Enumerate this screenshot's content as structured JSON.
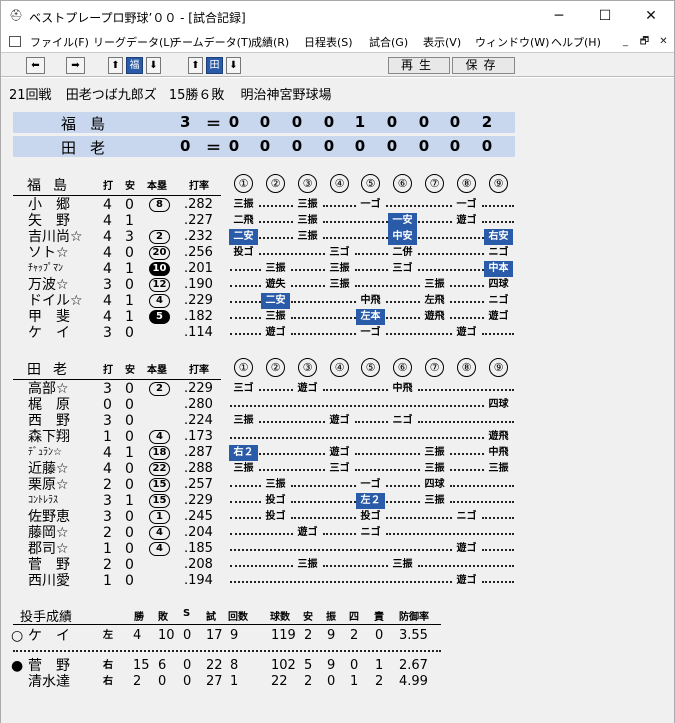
{
  "window": {
    "title": "ベストプレープロ野球’００ - [試合記録]",
    "minimize": "─",
    "maximize": "☐",
    "close": "✕"
  },
  "menu": [
    "ファイル(F)",
    "リーグデータ(L)",
    "チームデータ(T)",
    "成績(R)",
    "日程表(S)",
    "試合(G)",
    "表示(V)",
    "ウィンドウ(W)",
    "ヘルプ(H)"
  ],
  "mdi": {
    "minimize": "_",
    "restore": "🗗",
    "close": "✕"
  },
  "toolbar": {
    "prev": "⬅",
    "next": "➡",
    "up1": "⬆",
    "team1": "福",
    "down1": "⬇",
    "up2": "⬆",
    "team2": "田",
    "down2": "⬇",
    "play": "再生",
    "save": "保存"
  },
  "game": {
    "round": "21回戦",
    "pitchers": "田老つば九郎ズ",
    "record": "15勝６敗",
    "venue": "明治神宮野球場"
  },
  "scoreboard": [
    {
      "team": "福島",
      "total": "3",
      "eq": "＝",
      "innings": [
        "0",
        "0",
        "0",
        "0",
        "1",
        "0",
        "0",
        "0",
        "2"
      ]
    },
    {
      "team": "田老",
      "total": "0",
      "eq": "＝",
      "innings": [
        "0",
        "0",
        "0",
        "0",
        "0",
        "0",
        "0",
        "0",
        "0"
      ]
    }
  ],
  "col_headers": {
    "ab": "打",
    "hit": "安",
    "hr": "本塁",
    "avg": "打率",
    "innings": [
      "①",
      "②",
      "③",
      "④",
      "⑤",
      "⑥",
      "⑦",
      "⑧",
      "⑨"
    ]
  },
  "team_fukushima": {
    "name": "福島",
    "batters": [
      {
        "name": "小　郷",
        "ab": "4",
        "h": "0",
        "hr": "8",
        "hr_fill": false,
        "avg": ".282"
      },
      {
        "name": "矢　野",
        "ab": "4",
        "h": "1",
        "hr": "",
        "hr_fill": false,
        "avg": ".227"
      },
      {
        "name": "吉川尚☆",
        "ab": "4",
        "h": "3",
        "hr": "2",
        "hr_fill": false,
        "avg": ".232"
      },
      {
        "name": "ソト☆",
        "ab": "4",
        "h": "0",
        "hr": "20",
        "hr_fill": false,
        "avg": ".256"
      },
      {
        "name": "ﾁｬｯﾌﾟﾏﾝ",
        "ab": "4",
        "h": "1",
        "hr": "10",
        "hr_fill": true,
        "avg": ".201"
      },
      {
        "name": "万波☆",
        "ab": "3",
        "h": "0",
        "hr": "12",
        "hr_fill": false,
        "avg": ".190"
      },
      {
        "name": "ドイル☆",
        "ab": "4",
        "h": "1",
        "hr": "4",
        "hr_fill": false,
        "avg": ".229"
      },
      {
        "name": "甲　斐",
        "ab": "4",
        "h": "1",
        "hr": "5",
        "hr_fill": true,
        "avg": ".182"
      },
      {
        "name": "ケ　イ",
        "ab": "3",
        "h": "0",
        "hr": "",
        "hr_fill": false,
        "avg": ".114"
      }
    ],
    "results": [
      [
        {
          "c": 1,
          "t": "三振"
        },
        {
          "c": 3,
          "t": "三振"
        },
        {
          "c": 5,
          "t": "一ゴ"
        },
        {
          "c": 8,
          "t": "一ゴ"
        }
      ],
      [
        {
          "c": 1,
          "t": "二飛"
        },
        {
          "c": 3,
          "t": "三振"
        },
        {
          "c": 6,
          "t": "一安",
          "h": true
        },
        {
          "c": 8,
          "t": "遊ゴ"
        }
      ],
      [
        {
          "c": 1,
          "t": "二安",
          "h": true
        },
        {
          "c": 3,
          "t": "三振"
        },
        {
          "c": 6,
          "t": "中安",
          "h": true
        },
        {
          "c": 9,
          "t": "右安",
          "h": true
        }
      ],
      [
        {
          "c": 1,
          "t": "投ゴ"
        },
        {
          "c": 4,
          "t": "三ゴ"
        },
        {
          "c": 6,
          "t": "二併"
        },
        {
          "c": 9,
          "t": "ニゴ"
        }
      ],
      [
        {
          "c": 2,
          "t": "三振"
        },
        {
          "c": 4,
          "t": "三振"
        },
        {
          "c": 6,
          "t": "三ゴ"
        },
        {
          "c": 9,
          "t": "中本",
          "h": true
        }
      ],
      [
        {
          "c": 2,
          "t": "遊失"
        },
        {
          "c": 4,
          "t": "三振"
        },
        {
          "c": 7,
          "t": "三振"
        },
        {
          "c": 9,
          "t": "四球"
        }
      ],
      [
        {
          "c": 2,
          "t": "二安",
          "h": true
        },
        {
          "c": 5,
          "t": "中飛"
        },
        {
          "c": 7,
          "t": "左飛"
        },
        {
          "c": 9,
          "t": "ニゴ"
        }
      ],
      [
        {
          "c": 2,
          "t": "三振"
        },
        {
          "c": 5,
          "t": "左本",
          "h": true
        },
        {
          "c": 7,
          "t": "遊飛"
        },
        {
          "c": 9,
          "t": "遊ゴ"
        }
      ],
      [
        {
          "c": 2,
          "t": "遊ゴ"
        },
        {
          "c": 5,
          "t": "一ゴ"
        },
        {
          "c": 8,
          "t": "遊ゴ"
        }
      ]
    ]
  },
  "team_taro": {
    "name": "田老",
    "batters": [
      {
        "name": "高部☆",
        "ab": "3",
        "h": "0",
        "hr": "2",
        "hr_fill": false,
        "avg": ".229"
      },
      {
        "name": "梶　原",
        "ab": "0",
        "h": "0",
        "hr": "",
        "hr_fill": false,
        "avg": ".280"
      },
      {
        "name": "西　野",
        "ab": "3",
        "h": "0",
        "hr": "",
        "hr_fill": false,
        "avg": ".224"
      },
      {
        "name": "森下翔",
        "ab": "1",
        "h": "0",
        "hr": "4",
        "hr_fill": false,
        "avg": ".173"
      },
      {
        "name": "ﾃﾞｭﾗﾝ☆",
        "ab": "4",
        "h": "1",
        "hr": "18",
        "hr_fill": false,
        "avg": ".287"
      },
      {
        "name": "近藤☆",
        "ab": "4",
        "h": "0",
        "hr": "22",
        "hr_fill": false,
        "avg": ".288"
      },
      {
        "name": "栗原☆",
        "ab": "2",
        "h": "0",
        "hr": "15",
        "hr_fill": false,
        "avg": ".257"
      },
      {
        "name": "ｺﾝﾄﾚﾗｽ",
        "ab": "3",
        "h": "1",
        "hr": "15",
        "hr_fill": false,
        "avg": ".229"
      },
      {
        "name": "佐野恵",
        "ab": "3",
        "h": "0",
        "hr": "1",
        "hr_fill": false,
        "avg": ".245"
      },
      {
        "name": "藤岡☆",
        "ab": "2",
        "h": "0",
        "hr": "4",
        "hr_fill": false,
        "avg": ".204"
      },
      {
        "name": "郡司☆",
        "ab": "1",
        "h": "0",
        "hr": "4",
        "hr_fill": false,
        "avg": ".185"
      },
      {
        "name": "菅　野",
        "ab": "2",
        "h": "0",
        "hr": "",
        "hr_fill": false,
        "avg": ".208"
      },
      {
        "name": "西川愛",
        "ab": "1",
        "h": "0",
        "hr": "",
        "hr_fill": false,
        "avg": ".194"
      }
    ],
    "results": [
      [
        {
          "c": 1,
          "t": "三ゴ"
        },
        {
          "c": 3,
          "t": "遊ゴ"
        },
        {
          "c": 6,
          "t": "中飛"
        }
      ],
      [
        {
          "c": 9,
          "t": "四球"
        }
      ],
      [
        {
          "c": 1,
          "t": "三振"
        },
        {
          "c": 4,
          "t": "遊ゴ"
        },
        {
          "c": 6,
          "t": "ニゴ"
        }
      ],
      [
        {
          "c": 9,
          "t": "遊飛"
        }
      ],
      [
        {
          "c": 1,
          "t": "右２",
          "h": true
        },
        {
          "c": 4,
          "t": "遊ゴ"
        },
        {
          "c": 7,
          "t": "三振"
        },
        {
          "c": 9,
          "t": "中飛"
        }
      ],
      [
        {
          "c": 1,
          "t": "三振"
        },
        {
          "c": 4,
          "t": "三ゴ"
        },
        {
          "c": 7,
          "t": "三振"
        },
        {
          "c": 9,
          "t": "三振"
        }
      ],
      [
        {
          "c": 2,
          "t": "三振"
        },
        {
          "c": 5,
          "t": "一ゴ"
        },
        {
          "c": 7,
          "t": "四球"
        }
      ],
      [
        {
          "c": 2,
          "t": "投ゴ"
        },
        {
          "c": 5,
          "t": "左２",
          "h": true
        },
        {
          "c": 7,
          "t": "三振"
        }
      ],
      [
        {
          "c": 2,
          "t": "投ゴ"
        },
        {
          "c": 5,
          "t": "投ゴ"
        },
        {
          "c": 8,
          "t": "ニゴ"
        }
      ],
      [
        {
          "c": 3,
          "t": "遊ゴ"
        },
        {
          "c": 5,
          "t": "ニゴ"
        }
      ],
      [
        {
          "c": 8,
          "t": "遊ゴ"
        }
      ],
      [
        {
          "c": 3,
          "t": "三振"
        },
        {
          "c": 6,
          "t": "三振"
        }
      ],
      [
        {
          "c": 8,
          "t": "遊ゴ"
        }
      ]
    ]
  },
  "pitching": {
    "title": "投手成績",
    "headers": [
      "勝",
      "敗",
      "S",
      "試",
      "回数",
      "球数",
      "安",
      "振",
      "四",
      "責",
      "防御率"
    ],
    "rows": [
      {
        "mark": "○",
        "name": "ケ　イ",
        "hand": "左",
        "w": "4",
        "l": "10",
        "s": "0",
        "g": "17",
        "ip": "9",
        "np": "119",
        "h": "2",
        "k": "9",
        "bb": "2",
        "er": "0",
        "era": "3.55"
      },
      {
        "mark": "●",
        "name": "菅　野",
        "hand": "右",
        "w": "15",
        "l": "6",
        "s": "0",
        "g": "22",
        "ip": "8",
        "np": "102",
        "h": "5",
        "k": "9",
        "bb": "0",
        "er": "1",
        "era": "2.67"
      },
      {
        "mark": "",
        "name": "清水達",
        "hand": "右",
        "w": "2",
        "l": "0",
        "s": "0",
        "g": "27",
        "ip": "1",
        "np": "22",
        "h": "2",
        "k": "0",
        "bb": "1",
        "er": "2",
        "era": "4.99"
      }
    ]
  }
}
